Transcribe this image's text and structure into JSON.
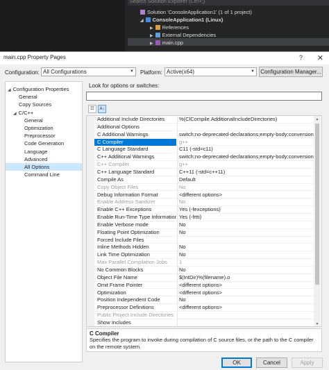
{
  "solution_explorer": {
    "search_placeholder": "Search Solution Explorer (Ctrl+;)",
    "items": [
      {
        "label": "Solution 'ConsoleApplication1' (1 of 1 project)",
        "bold": false
      },
      {
        "label": "ConsoleApplication1 (Linux)",
        "bold": true
      },
      {
        "label": "References",
        "bold": false
      },
      {
        "label": "External Dependencies",
        "bold": false
      },
      {
        "label": "main.cpp",
        "bold": false
      }
    ]
  },
  "dialog": {
    "title": "main.cpp Property Pages",
    "help_glyph": "?",
    "close_glyph": "✕",
    "configuration_label": "Configuration:",
    "configuration_value": "All Configurations",
    "platform_label": "Platform:",
    "platform_value": "Active(x64)",
    "config_manager_label": "Configuration Manager...",
    "look_for_label": "Look for options or switches:",
    "search_value": "",
    "ok_label": "OK",
    "cancel_label": "Cancel",
    "apply_label": "Apply"
  },
  "tree": [
    {
      "label": "Configuration Properties",
      "expander": "◢",
      "indent": 0
    },
    {
      "label": "General",
      "indent": 1
    },
    {
      "label": "Copy Sources",
      "indent": 1
    },
    {
      "label": "C/C++",
      "expander": "◢",
      "indent": 1
    },
    {
      "label": "General",
      "indent": 2
    },
    {
      "label": "Optimization",
      "indent": 2
    },
    {
      "label": "Preprocessor",
      "indent": 2
    },
    {
      "label": "Code Generation",
      "indent": 2
    },
    {
      "label": "Language",
      "indent": 2
    },
    {
      "label": "Advanced",
      "indent": 2
    },
    {
      "label": "All Options",
      "indent": 2,
      "selected": true
    },
    {
      "label": "Command Line",
      "indent": 2
    }
  ],
  "toolbar_icons": [
    "categorized-icon",
    "sort-alpha-icon"
  ],
  "properties": [
    {
      "name": "Additional Include Directories",
      "value": "%(ClCompile.AdditionalIncludeDirectories)"
    },
    {
      "name": "Additional Options",
      "value": ""
    },
    {
      "name": "C Additional Warnings",
      "value": "switch;no-deprecated-declarations;empty-body;conversion;ret"
    },
    {
      "name": "C Compiler",
      "value": "g++",
      "selected": true,
      "dimValue": true
    },
    {
      "name": "C Language Standard",
      "value": "C11 (-std=c11)"
    },
    {
      "name": "C++ Additional Warnings",
      "value": "switch;no-deprecated-declarations;empty-body;conversion;ret"
    },
    {
      "name": "C++ Compiler",
      "value": "g++",
      "dim": true
    },
    {
      "name": "C++ Language Standard",
      "value": "C++11 (-std=c++11)"
    },
    {
      "name": "Compile As",
      "value": "Default"
    },
    {
      "name": "Copy Object Files",
      "value": "No",
      "dim": true
    },
    {
      "name": "Debug Information Format",
      "value": "<different options>"
    },
    {
      "name": "Enable Address Sanitizer",
      "value": "No",
      "dim": true
    },
    {
      "name": "Enable C++ Exceptions",
      "value": "Yes (-fexceptions)"
    },
    {
      "name": "Enable Run-Time Type Information",
      "value": "Yes (-frtti)"
    },
    {
      "name": "Enable Verbose mode",
      "value": "No"
    },
    {
      "name": "Floating Point Optimization",
      "value": "No"
    },
    {
      "name": "Forced Include Files",
      "value": ""
    },
    {
      "name": "Inline Methods Hidden",
      "value": "No"
    },
    {
      "name": "Link Time Optimization",
      "value": "No"
    },
    {
      "name": "Max Parallel Compilation Jobs",
      "value": "1",
      "dim": true
    },
    {
      "name": "No Common Blocks",
      "value": "No"
    },
    {
      "name": "Object File Name",
      "value": "$(IntDir)%(filename).o"
    },
    {
      "name": "Omit Frame Pointer",
      "value": "<different options>"
    },
    {
      "name": "Optimization",
      "value": "<different options>"
    },
    {
      "name": "Position Independent Code",
      "value": "No"
    },
    {
      "name": "Preprocessor Definitions",
      "value": "<different options>"
    },
    {
      "name": "Public Project Include Directories",
      "value": "",
      "dim": true
    },
    {
      "name": "Show Includes",
      "value": ""
    }
  ],
  "description": {
    "title": "C Compiler",
    "body": "Specifies the program to invoke during compilation of C source files, or the path to the C compiler on the remote system."
  },
  "colors": {
    "selection": "#0078d7",
    "tree_selection": "#cce8ff",
    "vs_dark": "#252526"
  }
}
